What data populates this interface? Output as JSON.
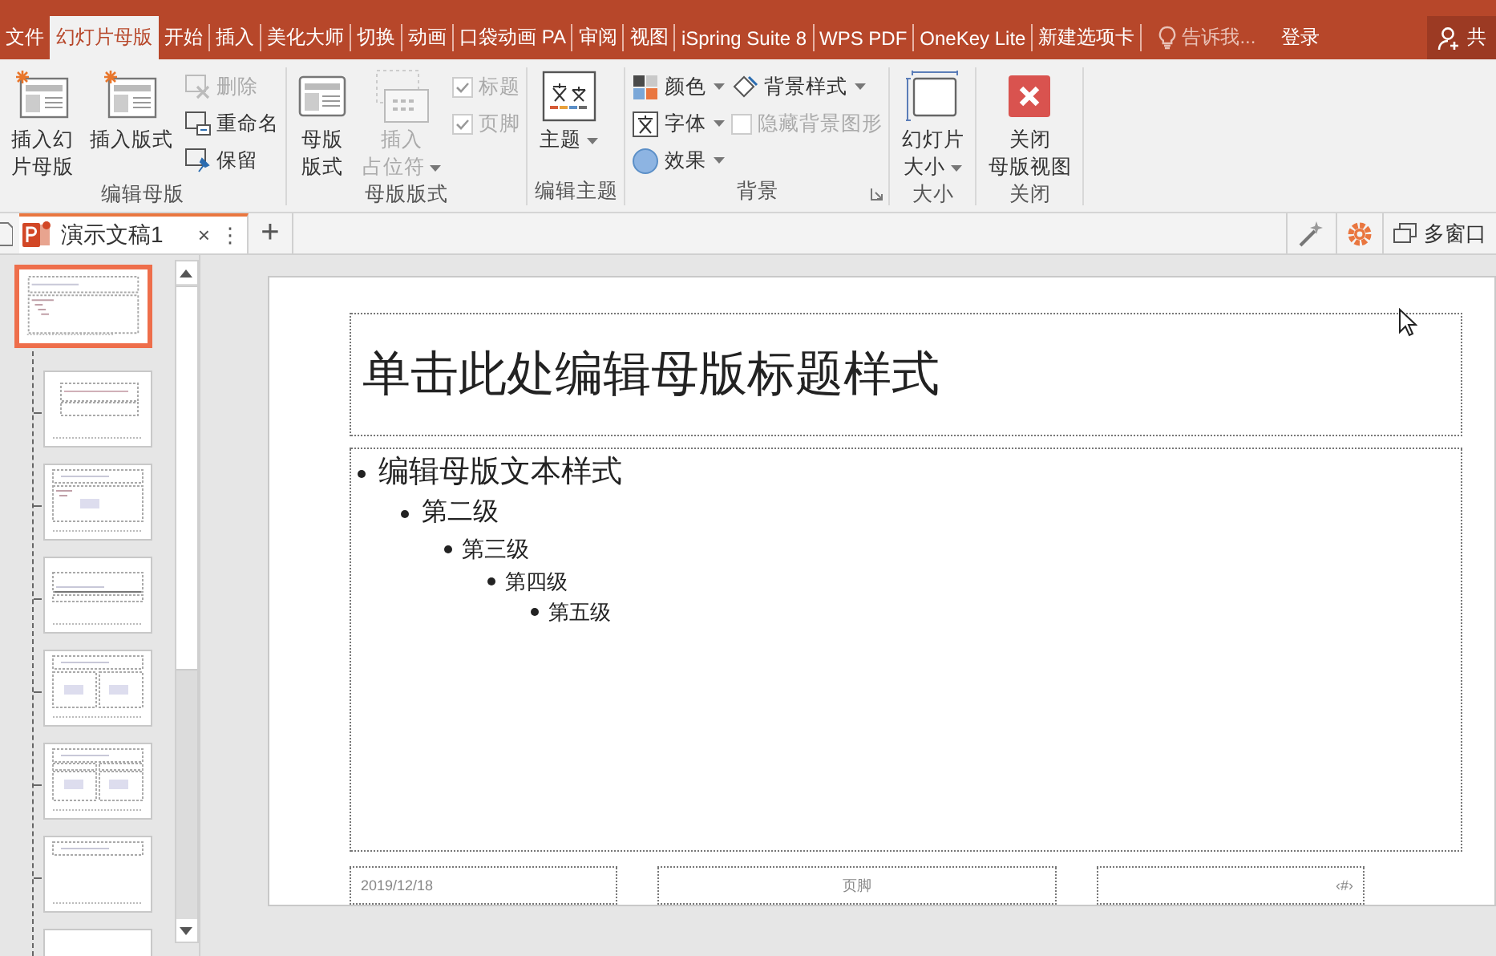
{
  "tabs": [
    {
      "label": "文件",
      "selected": false
    },
    {
      "label": "幻灯片母版",
      "selected": true
    },
    {
      "label": "开始",
      "selected": false
    },
    {
      "label": "插入",
      "selected": false
    },
    {
      "label": "美化大师",
      "selected": false
    },
    {
      "label": "切换",
      "selected": false
    },
    {
      "label": "动画",
      "selected": false
    },
    {
      "label": "口袋动画 PA",
      "selected": false
    },
    {
      "label": "审阅",
      "selected": false
    },
    {
      "label": "视图",
      "selected": false
    },
    {
      "label": "iSpring Suite 8",
      "selected": false
    },
    {
      "label": "WPS PDF",
      "selected": false
    },
    {
      "label": "OneKey Lite",
      "selected": false
    },
    {
      "label": "新建选项卡",
      "selected": false
    }
  ],
  "tell_me": "告诉我...",
  "sign_in": "登录",
  "share": "共",
  "ribbon": {
    "groups": [
      {
        "label": "编辑母版",
        "launcher": false,
        "items": [
          {
            "kind": "large",
            "lines": [
              "插入幻",
              "片母版"
            ],
            "disabled": false,
            "menu": false
          },
          {
            "kind": "large",
            "lines": [
              "插入版式"
            ],
            "disabled": false,
            "menu": false
          },
          {
            "kind": "column",
            "items": [
              {
                "kind": "small",
                "label": "删除",
                "disabled": true,
                "menu": false
              },
              {
                "kind": "small",
                "label": "重命名",
                "disabled": false,
                "menu": false
              },
              {
                "kind": "small",
                "label": "保留",
                "disabled": false,
                "menu": false
              }
            ]
          }
        ]
      },
      {
        "label": "母版版式",
        "launcher": false,
        "items": [
          {
            "kind": "large",
            "lines": [
              "母版",
              "版式"
            ],
            "disabled": false,
            "menu": false
          },
          {
            "kind": "large",
            "lines": [
              "插入",
              "占位符"
            ],
            "disabled": true,
            "menu": true
          },
          {
            "kind": "column",
            "items": [
              {
                "kind": "checkbox",
                "label": "标题",
                "checked": true,
                "disabled": true
              },
              {
                "kind": "checkbox",
                "label": "页脚",
                "checked": true,
                "disabled": true
              }
            ]
          }
        ]
      },
      {
        "label": "编辑主题",
        "launcher": false,
        "items": [
          {
            "kind": "large",
            "lines": [
              "主题"
            ],
            "disabled": false,
            "menu": true
          }
        ]
      },
      {
        "label": "背景",
        "launcher": true,
        "items": [
          {
            "kind": "column",
            "items": [
              {
                "kind": "small",
                "label": "颜色",
                "disabled": false,
                "menu": true
              },
              {
                "kind": "small",
                "label": "字体",
                "disabled": false,
                "menu": true
              },
              {
                "kind": "small",
                "label": "效果",
                "disabled": false,
                "menu": true
              }
            ]
          },
          {
            "kind": "column",
            "items": [
              {
                "kind": "small",
                "label": "背景样式",
                "disabled": false,
                "menu": true
              },
              {
                "kind": "checkbox",
                "label": "隐藏背景图形",
                "checked": false,
                "disabled": true
              }
            ]
          }
        ]
      },
      {
        "label": "大小",
        "launcher": false,
        "items": [
          {
            "kind": "large",
            "lines": [
              "幻灯片",
              "大小"
            ],
            "disabled": false,
            "menu": true
          }
        ]
      },
      {
        "label": "关闭",
        "launcher": false,
        "items": [
          {
            "kind": "large",
            "lines": [
              "关闭",
              "母版视图"
            ],
            "disabled": false,
            "menu": false
          }
        ]
      }
    ]
  },
  "document_tab": {
    "title": "演示文稿1",
    "close": "×",
    "more": "⋮",
    "new": "+"
  },
  "multi_window": "多窗口",
  "thumbnails": [
    {
      "kind": "master",
      "selected": true
    },
    {
      "kind": "title",
      "selected": false
    },
    {
      "kind": "content",
      "selected": false
    },
    {
      "kind": "section",
      "selected": false
    },
    {
      "kind": "two",
      "selected": false
    },
    {
      "kind": "comparison",
      "selected": false
    },
    {
      "kind": "titleonly",
      "selected": false
    },
    {
      "kind": "blank",
      "selected": false
    }
  ],
  "slide": {
    "title": "单击此处编辑母版标题样式",
    "levels": [
      {
        "text": "编辑母版文本样式",
        "children": [
          {
            "text": "第二级",
            "children": [
              {
                "text": "第三级",
                "children": [
                  {
                    "text": "第四级",
                    "children": [
                      {
                        "text": "第五级"
                      }
                    ]
                  }
                ]
              }
            ]
          }
        ]
      }
    ],
    "date": "2019/12/18",
    "footer": "页脚",
    "number": "‹#›"
  }
}
